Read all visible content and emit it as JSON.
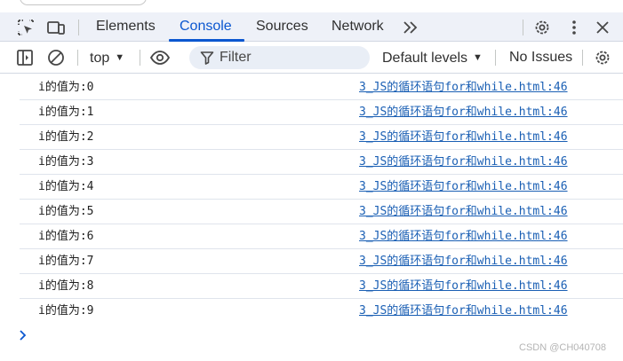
{
  "tabs": [
    {
      "label": "Elements",
      "active": false
    },
    {
      "label": "Console",
      "active": true
    },
    {
      "label": "Sources",
      "active": false
    },
    {
      "label": "Network",
      "active": false
    }
  ],
  "toolbar": {
    "context": "top",
    "filter_placeholder": "Filter",
    "levels": "Default levels",
    "issues": "No Issues"
  },
  "console": {
    "messages": [
      {
        "text": "i的值为:0",
        "source": "3_JS的循环语句for和while.html:46"
      },
      {
        "text": "i的值为:1",
        "source": "3_JS的循环语句for和while.html:46"
      },
      {
        "text": "i的值为:2",
        "source": "3_JS的循环语句for和while.html:46"
      },
      {
        "text": "i的值为:3",
        "source": "3_JS的循环语句for和while.html:46"
      },
      {
        "text": "i的值为:4",
        "source": "3_JS的循环语句for和while.html:46"
      },
      {
        "text": "i的值为:5",
        "source": "3_JS的循环语句for和while.html:46"
      },
      {
        "text": "i的值为:6",
        "source": "3_JS的循环语句for和while.html:46"
      },
      {
        "text": "i的值为:7",
        "source": "3_JS的循环语句for和while.html:46"
      },
      {
        "text": "i的值为:8",
        "source": "3_JS的循环语句for和while.html:46"
      },
      {
        "text": "i的值为:9",
        "source": "3_JS的循环语句for和while.html:46"
      }
    ]
  },
  "watermark": "CSDN @CH040708",
  "colors": {
    "accent": "#0b57d0",
    "link": "#1a5fb4",
    "tabbar_bg": "#eef1f8",
    "filter_bg": "#e9eef6"
  },
  "icons": [
    "inspect-element-icon",
    "device-toolbar-icon",
    "more-tabs-icon",
    "settings-gear-icon",
    "kebab-menu-icon",
    "close-icon",
    "sidebar-toggle-icon",
    "clear-console-icon",
    "eye-icon",
    "filter-funnel-icon",
    "prompt-chevron-icon"
  ]
}
